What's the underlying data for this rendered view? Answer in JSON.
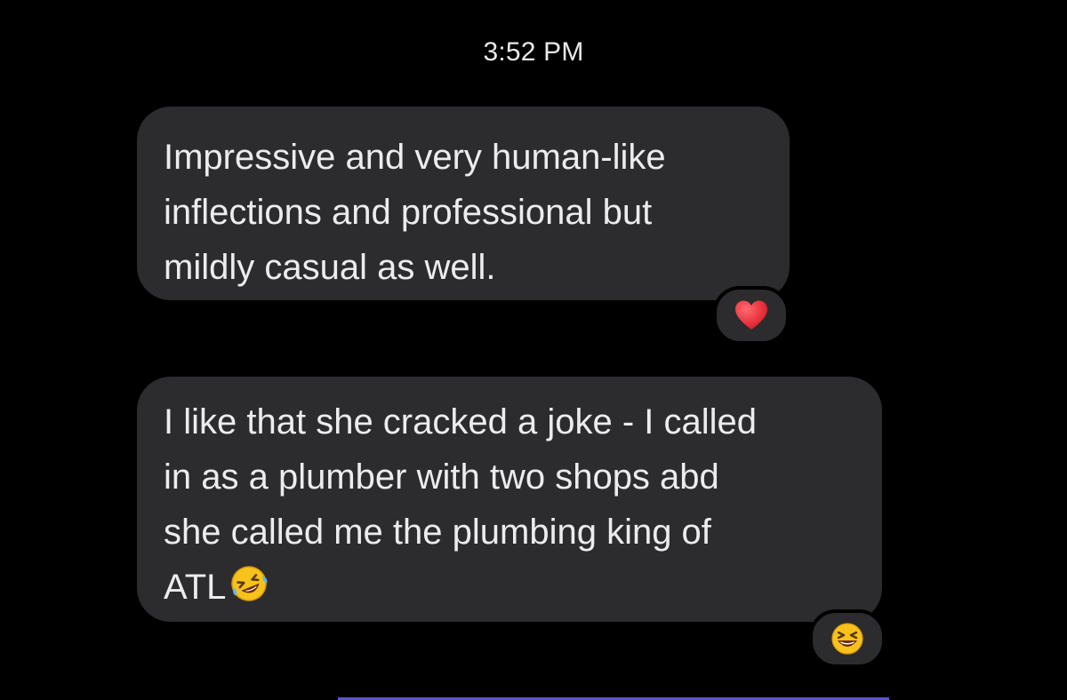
{
  "timestamp": "3:52 PM",
  "messages": [
    {
      "lines": [
        "Impressive and very human-like",
        "inflections and professional but",
        "mildly casual as well."
      ],
      "reaction_icon": "red-heart-icon"
    },
    {
      "lines": [
        "I like that she cracked a joke - I called",
        "in as a plumber with two shops abd",
        "she called me the plumbing king of",
        "ATL"
      ],
      "inline_emoji_icon": "rolling-on-floor-laughing-icon",
      "reaction_icon": "grinning-squinting-face-icon"
    }
  ],
  "colors": {
    "background": "#000000",
    "bubble": "#2c2c2e",
    "text": "#ececef",
    "heart": "#e0242f",
    "emoji_face": "#f7c21b"
  }
}
